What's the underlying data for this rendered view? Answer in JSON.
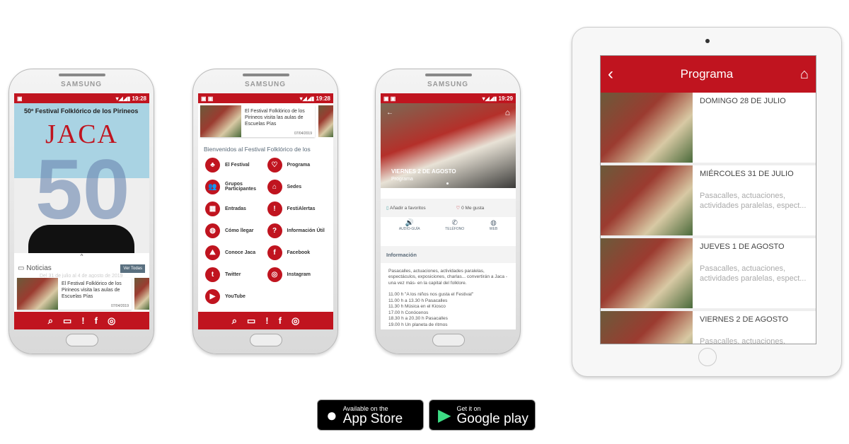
{
  "status": {
    "time1": "19:28",
    "time2": "19:28",
    "time3": "19:29",
    "icons": "▾◢◢▮"
  },
  "device_brand": "SAMSUNG",
  "phone1": {
    "poster_title": "50º Festival Folklórico de los Pirineos",
    "poster_logo": "JACA",
    "poster_number": "50",
    "noticias_label": "Noticias",
    "ver_todas": "Ver Todas",
    "dates": "Del 31 de julio al 4 de agosto de 2019",
    "news": {
      "title": "El Festival Folklórico de los Pirineos visita las aulas de Escuelas Pías",
      "date": "07/04/2019"
    }
  },
  "phone2": {
    "news": {
      "title": "El Festival Folklórico de los Pirineos visita las aulas de Escuelas Pías",
      "date": "07/04/2019"
    },
    "welcome": "Bienvenidos al Festival Folklórico de los",
    "menu": [
      {
        "label": "El Festival",
        "icon": "♣"
      },
      {
        "label": "Programa",
        "icon": "♡"
      },
      {
        "label": "Grupos Participantes",
        "icon": "👥"
      },
      {
        "label": "Sedes",
        "icon": "⌂"
      },
      {
        "label": "Entradas",
        "icon": "▦"
      },
      {
        "label": "FestiAlertas",
        "icon": "!"
      },
      {
        "label": "Cómo llegar",
        "icon": "◍"
      },
      {
        "label": "Información Útil",
        "icon": "?"
      },
      {
        "label": "Conoce Jaca",
        "icon": "⛰"
      },
      {
        "label": "Facebook",
        "icon": "f"
      },
      {
        "label": "Twitter",
        "icon": "t"
      },
      {
        "label": "Instagram",
        "icon": "◎"
      },
      {
        "label": "YouTube",
        "icon": "▶"
      }
    ]
  },
  "bottom_nav": [
    "⌕",
    "▭",
    "!",
    "f",
    "◎"
  ],
  "phone3": {
    "hero_title": "VIERNES 2 DE AGOSTO",
    "hero_sub": "Programa",
    "favorites": "Añadir a favoritos",
    "likes": "0 Me gusta",
    "actions": [
      {
        "label": "AUDIO-GUÍA",
        "icon": "🔊"
      },
      {
        "label": "TELÉFONO",
        "icon": "✆"
      },
      {
        "label": "WEB",
        "icon": "◍"
      }
    ],
    "info_header": "Información",
    "info_text": "Pasacalles, actuaciones, actividades paralelas, espectáculos, exposiciones, charlas... convertirán a Jaca -una vez más- en la capital del folklore.",
    "schedule": [
      "11.00 h \"A los niños nos gusta el Festival\"",
      "11.00 h a 13.30 h Pasacalles",
      "11.30 h Música en el Kiosco",
      "17.00 h Conócenos",
      "18.30 h a 20.30 h Pasacalles",
      "19.00 h Un planeta de ritmos"
    ]
  },
  "tablet": {
    "title": "Programa",
    "rows": [
      {
        "date": "DOMINGO 28 DE JULIO",
        "summary": ""
      },
      {
        "date": "MIÉRCOLES 31 DE JULIO",
        "summary": "Pasacalles, actuaciones, actividades paralelas, espect..."
      },
      {
        "date": "JUEVES 1 DE AGOSTO",
        "summary": "Pasacalles, actuaciones, actividades paralelas, espect..."
      },
      {
        "date": "VIERNES 2 DE AGOSTO",
        "summary": "Pasacalles, actuaciones, actividades paralelas, espect..."
      }
    ]
  },
  "badges": {
    "appstore_small": "Available on the",
    "appstore_large": "App Store",
    "google_small": "Get it on",
    "google_large": "Google play"
  },
  "colors": {
    "brand_red": "#c0141f"
  }
}
